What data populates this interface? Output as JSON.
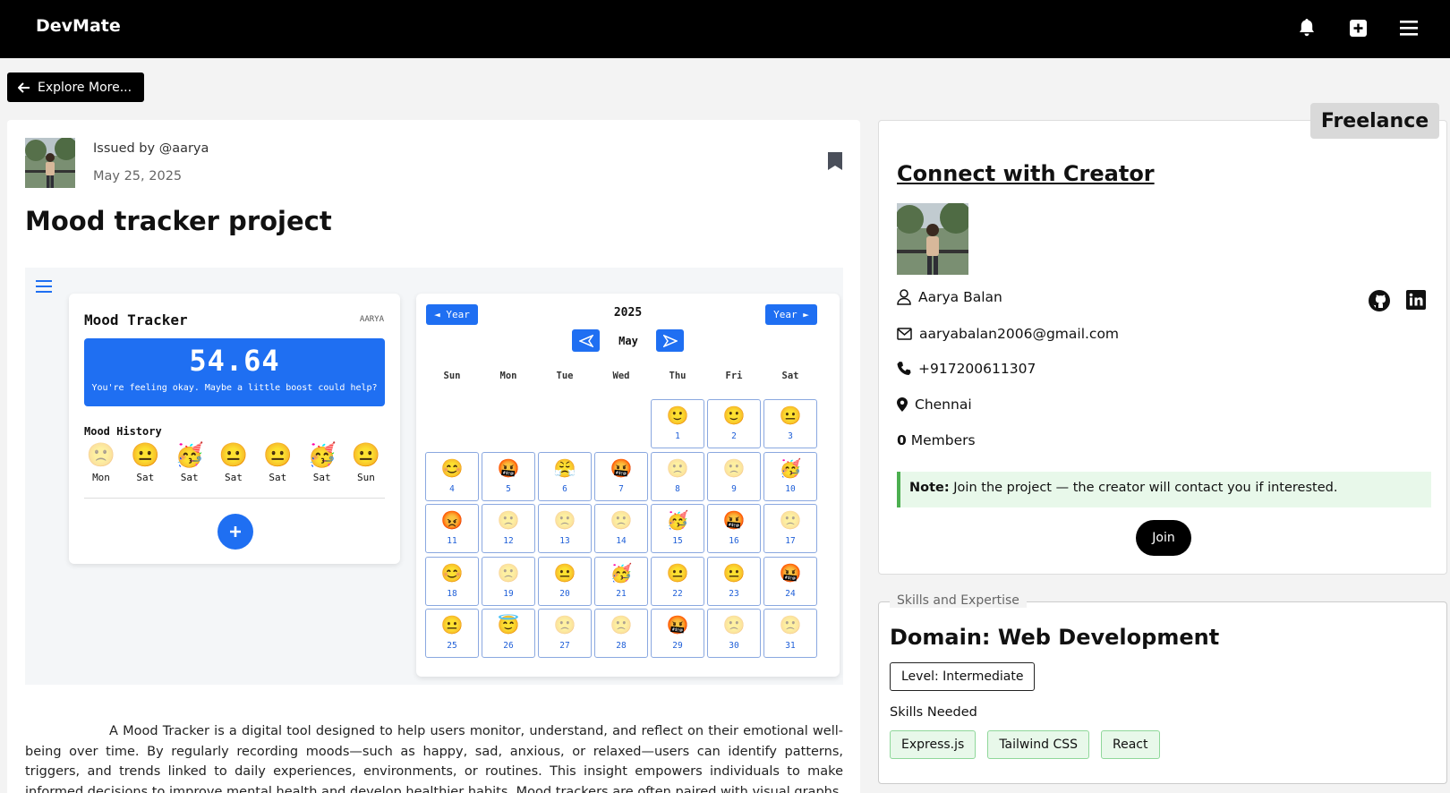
{
  "app": {
    "brand": "DevMate"
  },
  "nav": {
    "explore_label": "Explore More..."
  },
  "post": {
    "issued_by": "Issued by @aarya",
    "date": "May 25, 2025",
    "title": "Mood tracker project",
    "description": "A Mood Tracker is a digital tool designed to help users monitor, understand, and reflect on their emotional well-being over time. By regularly recording moods—such as happy, sad, anxious, or relaxed—users can identify patterns, triggers, and trends linked to daily experiences, environments, or routines. This insight empowers individuals to make informed decisions to improve mental health and develop healthier habits. Mood trackers are often paired with visual graphs, notes, and memory logs."
  },
  "mood_tracker": {
    "title": "Mood Tracker",
    "user": "AARYA",
    "score": "54.64",
    "message": "You're feeling okay. Maybe a little boost could help?",
    "history_label": "Mood History",
    "history": [
      {
        "emoji": "🙁",
        "day": "Mon",
        "faded": true
      },
      {
        "emoji": "😐",
        "day": "Sat",
        "faded": false
      },
      {
        "emoji": "🥳",
        "day": "Sat",
        "faded": false
      },
      {
        "emoji": "😐",
        "day": "Sat",
        "faded": false
      },
      {
        "emoji": "😐",
        "day": "Sat",
        "faded": false
      },
      {
        "emoji": "🥳",
        "day": "Sat",
        "faded": false
      },
      {
        "emoji": "😐",
        "day": "Sun",
        "faded": false
      }
    ]
  },
  "calendar": {
    "prev_year": "◄ Year",
    "next_year": "Year ►",
    "year": "2025",
    "month": "May",
    "weekdays": [
      "Sun",
      "Mon",
      "Tue",
      "Wed",
      "Thu",
      "Fri",
      "Sat"
    ],
    "first_weekday": 4,
    "days": [
      {
        "n": "1",
        "e": "🙂"
      },
      {
        "n": "2",
        "e": "🙂"
      },
      {
        "n": "3",
        "e": "😐"
      },
      {
        "n": "4",
        "e": "😊"
      },
      {
        "n": "5",
        "e": "🤬"
      },
      {
        "n": "6",
        "e": "😤"
      },
      {
        "n": "7",
        "e": "🤬"
      },
      {
        "n": "8",
        "e": "🙁",
        "f": true
      },
      {
        "n": "9",
        "e": "🙁",
        "f": true
      },
      {
        "n": "10",
        "e": "🥳"
      },
      {
        "n": "11",
        "e": "😡"
      },
      {
        "n": "12",
        "e": "🙁",
        "f": true
      },
      {
        "n": "13",
        "e": "🙁",
        "f": true
      },
      {
        "n": "14",
        "e": "🙁",
        "f": true
      },
      {
        "n": "15",
        "e": "🥳"
      },
      {
        "n": "16",
        "e": "🤬"
      },
      {
        "n": "17",
        "e": "🙁",
        "f": true
      },
      {
        "n": "18",
        "e": "😊"
      },
      {
        "n": "19",
        "e": "🙁",
        "f": true
      },
      {
        "n": "20",
        "e": "😐"
      },
      {
        "n": "21",
        "e": "🥳"
      },
      {
        "n": "22",
        "e": "😐"
      },
      {
        "n": "23",
        "e": "😐"
      },
      {
        "n": "24",
        "e": "🤬"
      },
      {
        "n": "25",
        "e": "😐"
      },
      {
        "n": "26",
        "e": "😇"
      },
      {
        "n": "27",
        "e": "🙁",
        "f": true
      },
      {
        "n": "28",
        "e": "🙁",
        "f": true
      },
      {
        "n": "29",
        "e": "🤬"
      },
      {
        "n": "30",
        "e": "🙁",
        "f": true
      },
      {
        "n": "31",
        "e": "🙁",
        "f": true
      }
    ]
  },
  "creator": {
    "badge": "Freelance",
    "heading": "Connect with Creator",
    "name": "Aarya Balan",
    "email": "aaryabalan2006@gmail.com",
    "phone": "+917200611307",
    "location": "Chennai",
    "members_count": "0",
    "members_label": " Members",
    "note_label": "Note:",
    "note_text": " Join the project — the creator will contact you if interested.",
    "join_label": "Join"
  },
  "skills": {
    "legend": "Skills and Expertise",
    "domain": "Domain: Web Development",
    "level": "Level: Intermediate",
    "needed_label": "Skills Needed",
    "tags": [
      "Express.js",
      "Tailwind CSS",
      "React"
    ]
  },
  "colors": {
    "accent": "#1f6ff2",
    "note_bg": "#e8f8ea",
    "note_border": "#4caf50"
  }
}
